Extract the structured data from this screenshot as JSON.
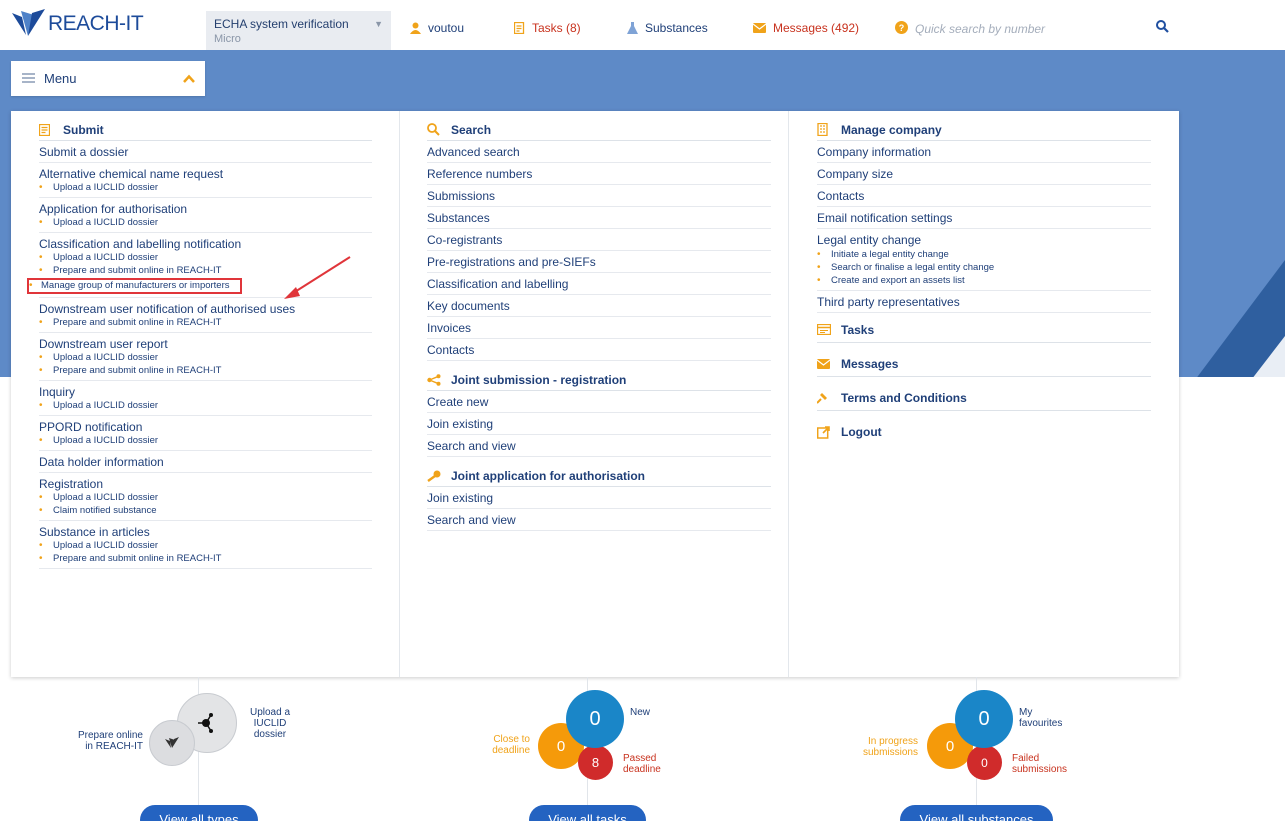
{
  "header": {
    "logo_text": "REACH-IT",
    "account_name": "ECHA system verification",
    "account_size": "Micro",
    "user": "voutou",
    "tasks": "Tasks (8)",
    "substances": "Substances",
    "messages": "Messages (492)",
    "search_placeholder": "Quick search by number"
  },
  "menu_toggle": {
    "label": "Menu"
  },
  "menu": {
    "submit": {
      "title": "Submit",
      "items": [
        {
          "label": "Submit a dossier",
          "subs": []
        },
        {
          "label": "Alternative chemical name request",
          "subs": [
            "Upload a IUCLID dossier"
          ]
        },
        {
          "label": "Application for authorisation",
          "subs": [
            "Upload a IUCLID dossier"
          ]
        },
        {
          "label": "Classification and labelling notification",
          "subs": [
            "Upload a IUCLID dossier",
            "Prepare and submit online in REACH-IT",
            "Manage group of manufacturers or importers"
          ]
        },
        {
          "label": "Downstream user notification of authorised uses",
          "subs": [
            "Prepare and submit online in REACH-IT"
          ]
        },
        {
          "label": "Downstream user report",
          "subs": [
            "Upload a IUCLID dossier",
            "Prepare and submit online in REACH-IT"
          ]
        },
        {
          "label": "Inquiry",
          "subs": [
            "Upload a IUCLID dossier"
          ]
        },
        {
          "label": "PPORD notification",
          "subs": [
            "Upload a IUCLID dossier"
          ]
        },
        {
          "label": "Data holder information",
          "subs": []
        },
        {
          "label": "Registration",
          "subs": [
            "Upload a IUCLID dossier",
            "Claim notified substance"
          ]
        },
        {
          "label": "Substance in articles",
          "subs": [
            "Upload a IUCLID dossier",
            "Prepare and submit online in REACH-IT"
          ]
        }
      ]
    },
    "search": {
      "title": "Search",
      "items": [
        "Advanced search",
        "Reference numbers",
        "Submissions",
        "Substances",
        "Co-registrants",
        "Pre-registrations and pre-SIEFs",
        "Classification and labelling",
        "Key documents",
        "Invoices",
        "Contacts"
      ]
    },
    "joint_submission": {
      "title": "Joint submission - registration",
      "items": [
        "Create new",
        "Join existing",
        "Search and view"
      ]
    },
    "joint_application": {
      "title": "Joint application for authorisation",
      "items": [
        "Join existing",
        "Search and view"
      ]
    },
    "manage_company": {
      "title": "Manage company",
      "items": [
        "Company information",
        "Company size",
        "Contacts",
        "Email notification settings"
      ],
      "legal_entity": {
        "label": "Legal entity change",
        "subs": [
          "Initiate a legal entity change",
          "Search or finalise a legal entity change",
          "Create and export an assets list"
        ]
      },
      "third_party": "Third party representatives"
    },
    "tasks": "Tasks",
    "messages": "Messages",
    "terms": "Terms and Conditions",
    "logout": "Logout"
  },
  "widgets": {
    "submissions": {
      "prepare_online": "Prepare online\nin REACH-IT",
      "upload_iuclid": "Upload a\nIUCLID\ndossier",
      "button": "View all types"
    },
    "tasks": {
      "new_count": "0",
      "new_label": "New",
      "close_count": "0",
      "close_label": "Close to\ndeadline",
      "passed_count": "8",
      "passed_label": "Passed\ndeadline",
      "button": "View all tasks"
    },
    "substances": {
      "fav_count": "0",
      "fav_label": "My\nfavourites",
      "progress_count": "0",
      "progress_label": "In progress\nsubmissions",
      "failed_count": "0",
      "failed_label": "Failed\nsubmissions",
      "button": "View all substances"
    }
  },
  "colors": {
    "brand_blue": "#1d4b9a",
    "band": "#5e8ac7",
    "accent_orange": "#f0a31a",
    "alert_red": "#c8321e",
    "circle_blue": "#1a86c8",
    "circle_red": "#d02b2b",
    "circle_orange": "#f59a0a"
  }
}
